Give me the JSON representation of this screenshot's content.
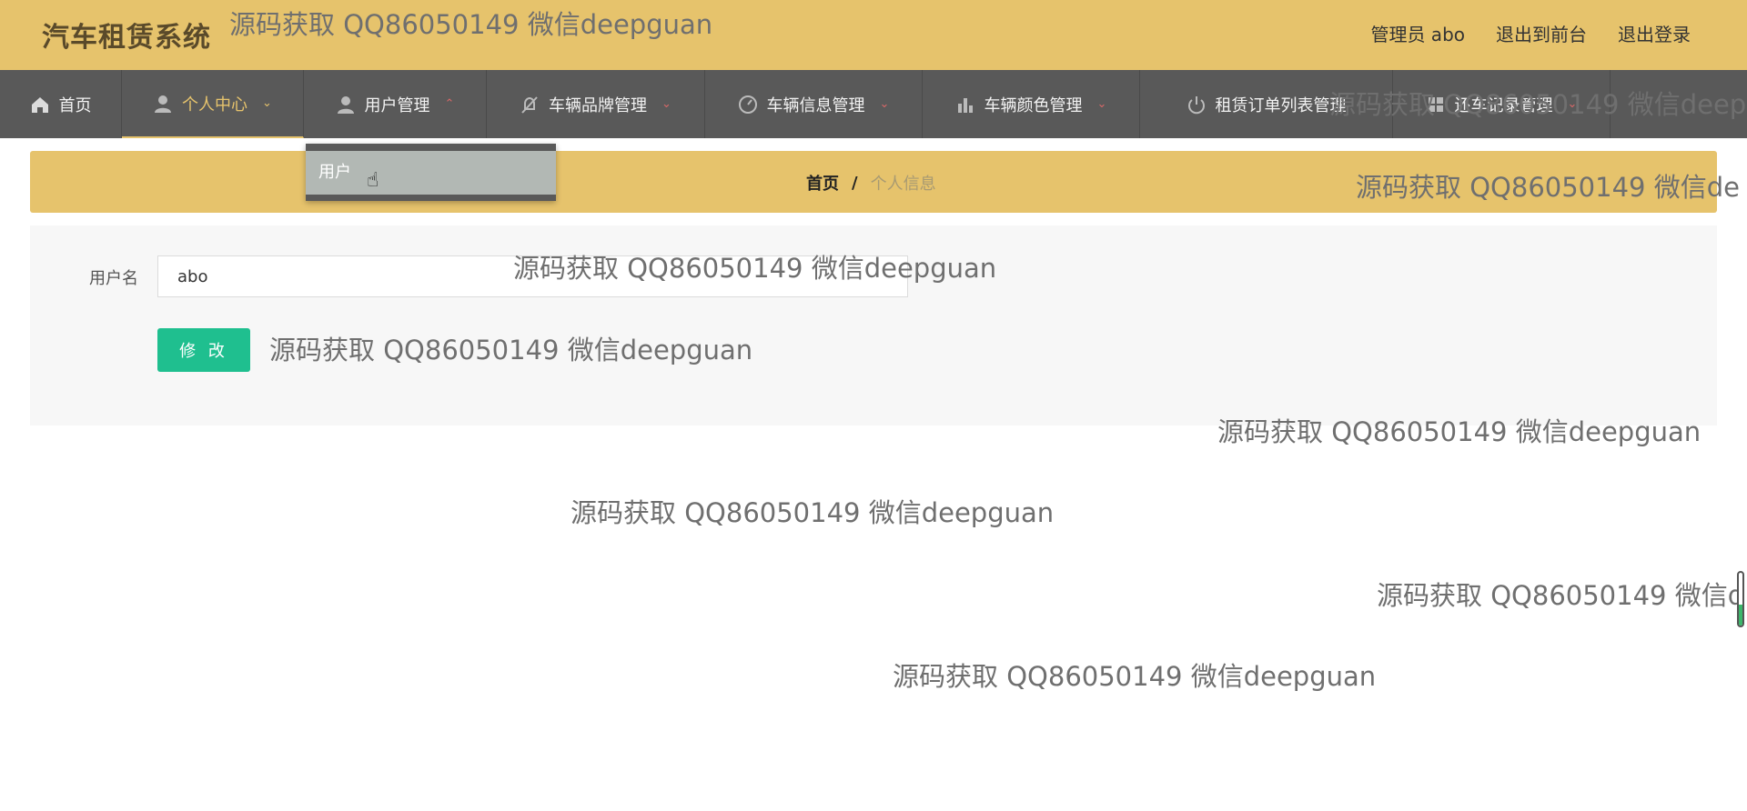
{
  "header": {
    "title": "汽车租赁系统",
    "admin_label": "管理员 abo",
    "exit_front": "退出到前台",
    "logout": "退出登录"
  },
  "nav": {
    "items": [
      {
        "label": "首页",
        "icon": "home-icon"
      },
      {
        "label": "个人中心",
        "icon": "user-icon"
      },
      {
        "label": "用户管理",
        "icon": "user-icon"
      },
      {
        "label": "车辆品牌管理",
        "icon": "bell-off-icon"
      },
      {
        "label": "车辆信息管理",
        "icon": "gauge-icon"
      },
      {
        "label": "车辆颜色管理",
        "icon": "bar-chart-icon"
      },
      {
        "label": "租赁订单列表管理",
        "icon": "power-icon"
      },
      {
        "label": "还车记录管理",
        "icon": "grid-icon"
      }
    ],
    "active_index": 1
  },
  "dropdown": {
    "items": [
      "用户"
    ]
  },
  "breadcrumb": {
    "home": "首页",
    "separator": "/",
    "current": "个人信息"
  },
  "form": {
    "username_label": "用户名",
    "username_value": "abo",
    "submit_label": "修 改"
  },
  "watermarks": {
    "text_1": "源码获取 QQ86050149 微信deepguan",
    "text_2": "源码获取 QQ86050149 微信deep",
    "text_3": "源码获取 QQ86050149 微信de",
    "text_4": "源码获取 QQ86050149 微信deepguan",
    "text_5": "源码获取 QQ86050149 微信deepguan",
    "text_6": "源码获取 QQ86050149 微信deepguan",
    "text_7": "源码获取 QQ86050149 微信deepguan",
    "text_8": "源码获取 QQ86050149 微信d",
    "text_9": "源码获取 QQ86050149 微信deepguan"
  },
  "colors": {
    "header_bg": "#e6c36c",
    "nav_bg": "#595959",
    "accent": "#e6c36c",
    "button_bg": "#1fbf8f"
  }
}
